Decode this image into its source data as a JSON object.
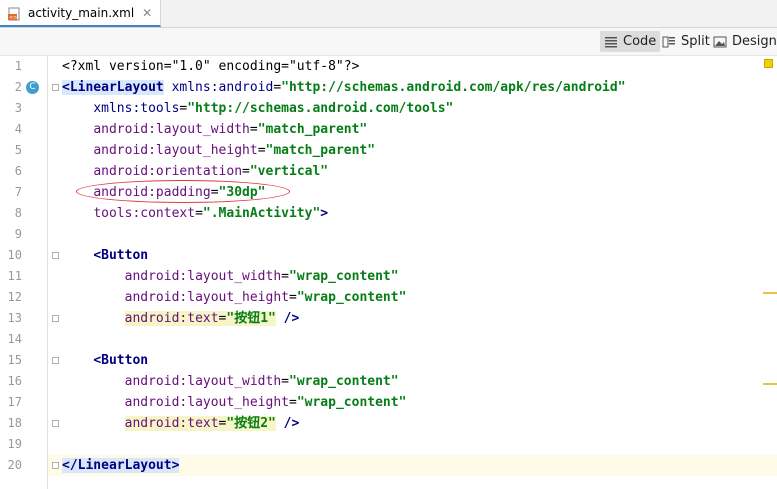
{
  "tab": {
    "filename": "activity_main.xml",
    "close": "✕"
  },
  "view_modes": [
    {
      "label": "Code",
      "active": true
    },
    {
      "label": "Split",
      "active": false
    },
    {
      "label": "Design",
      "active": false
    }
  ],
  "gutter_badge": "C",
  "lines": [
    {
      "n": "1",
      "segs": [
        {
          "t": "<?xml version=\"1.0\" encoding=\"utf-8\"?>",
          "c": "pi"
        }
      ]
    },
    {
      "n": "2",
      "segs": [
        {
          "t": "<LinearLayout",
          "c": "tag hl-tag"
        },
        {
          "t": " ",
          "c": "plain"
        },
        {
          "t": "xmlns:android",
          "c": "ns"
        },
        {
          "t": "=",
          "c": "plain"
        },
        {
          "t": "\"http://schemas.android.com/apk/res/android\"",
          "c": "val"
        }
      ]
    },
    {
      "n": "3",
      "segs": [
        {
          "t": "    ",
          "c": "plain"
        },
        {
          "t": "xmlns:tools",
          "c": "ns"
        },
        {
          "t": "=",
          "c": "plain"
        },
        {
          "t": "\"http://schemas.android.com/tools\"",
          "c": "val"
        }
      ]
    },
    {
      "n": "4",
      "segs": [
        {
          "t": "    ",
          "c": "plain"
        },
        {
          "t": "android:layout_width",
          "c": "attr"
        },
        {
          "t": "=",
          "c": "plain"
        },
        {
          "t": "\"match_parent\"",
          "c": "val"
        }
      ]
    },
    {
      "n": "5",
      "segs": [
        {
          "t": "    ",
          "c": "plain"
        },
        {
          "t": "android:layout_height",
          "c": "attr"
        },
        {
          "t": "=",
          "c": "plain"
        },
        {
          "t": "\"match_parent\"",
          "c": "val"
        }
      ]
    },
    {
      "n": "6",
      "segs": [
        {
          "t": "    ",
          "c": "plain"
        },
        {
          "t": "android:orientation",
          "c": "attr"
        },
        {
          "t": "=",
          "c": "plain"
        },
        {
          "t": "\"vertical\"",
          "c": "val"
        }
      ]
    },
    {
      "n": "7",
      "segs": [
        {
          "t": "    ",
          "c": "plain"
        },
        {
          "t": "android:padding",
          "c": "attr"
        },
        {
          "t": "=",
          "c": "plain"
        },
        {
          "t": "\"30dp\"",
          "c": "val"
        }
      ]
    },
    {
      "n": "8",
      "segs": [
        {
          "t": "    ",
          "c": "plain"
        },
        {
          "t": "tools:context",
          "c": "attr"
        },
        {
          "t": "=",
          "c": "plain"
        },
        {
          "t": "\".MainActivity\"",
          "c": "val"
        },
        {
          "t": ">",
          "c": "tag"
        }
      ]
    },
    {
      "n": "9",
      "segs": []
    },
    {
      "n": "10",
      "segs": [
        {
          "t": "    ",
          "c": "plain"
        },
        {
          "t": "<Button",
          "c": "tag"
        }
      ]
    },
    {
      "n": "11",
      "segs": [
        {
          "t": "        ",
          "c": "plain"
        },
        {
          "t": "android:layout_width",
          "c": "attr"
        },
        {
          "t": "=",
          "c": "plain"
        },
        {
          "t": "\"wrap_content\"",
          "c": "val"
        }
      ]
    },
    {
      "n": "12",
      "segs": [
        {
          "t": "        ",
          "c": "plain"
        },
        {
          "t": "android:layout_height",
          "c": "attr"
        },
        {
          "t": "=",
          "c": "plain"
        },
        {
          "t": "\"wrap_content\"",
          "c": "val"
        }
      ]
    },
    {
      "n": "13",
      "segs": [
        {
          "t": "        ",
          "c": "plain"
        },
        {
          "t": "android:text",
          "c": "attr hl-attr"
        },
        {
          "t": "=",
          "c": "plain hl-attr"
        },
        {
          "t": "\"按钮1\"",
          "c": "val hl-attr"
        },
        {
          "t": " />",
          "c": "tag"
        }
      ]
    },
    {
      "n": "14",
      "segs": []
    },
    {
      "n": "15",
      "segs": [
        {
          "t": "    ",
          "c": "plain"
        },
        {
          "t": "<Button",
          "c": "tag"
        }
      ]
    },
    {
      "n": "16",
      "segs": [
        {
          "t": "        ",
          "c": "plain"
        },
        {
          "t": "android:layout_width",
          "c": "attr"
        },
        {
          "t": "=",
          "c": "plain"
        },
        {
          "t": "\"wrap_content\"",
          "c": "val"
        }
      ]
    },
    {
      "n": "17",
      "segs": [
        {
          "t": "        ",
          "c": "plain"
        },
        {
          "t": "android:layout_height",
          "c": "attr"
        },
        {
          "t": "=",
          "c": "plain"
        },
        {
          "t": "\"wrap_content\"",
          "c": "val"
        }
      ]
    },
    {
      "n": "18",
      "segs": [
        {
          "t": "        ",
          "c": "plain"
        },
        {
          "t": "android:text",
          "c": "attr hl-attr"
        },
        {
          "t": "=",
          "c": "plain hl-attr"
        },
        {
          "t": "\"按钮2\"",
          "c": "val hl-attr"
        },
        {
          "t": " />",
          "c": "tag"
        }
      ]
    },
    {
      "n": "19",
      "segs": []
    },
    {
      "n": "20",
      "segs": [
        {
          "t": "</LinearLayout>",
          "c": "tag hl-tag"
        }
      ]
    }
  ],
  "colors": {
    "accent": "#4083c9",
    "annotation": "#e03a3a",
    "warning": "#f0d000"
  }
}
